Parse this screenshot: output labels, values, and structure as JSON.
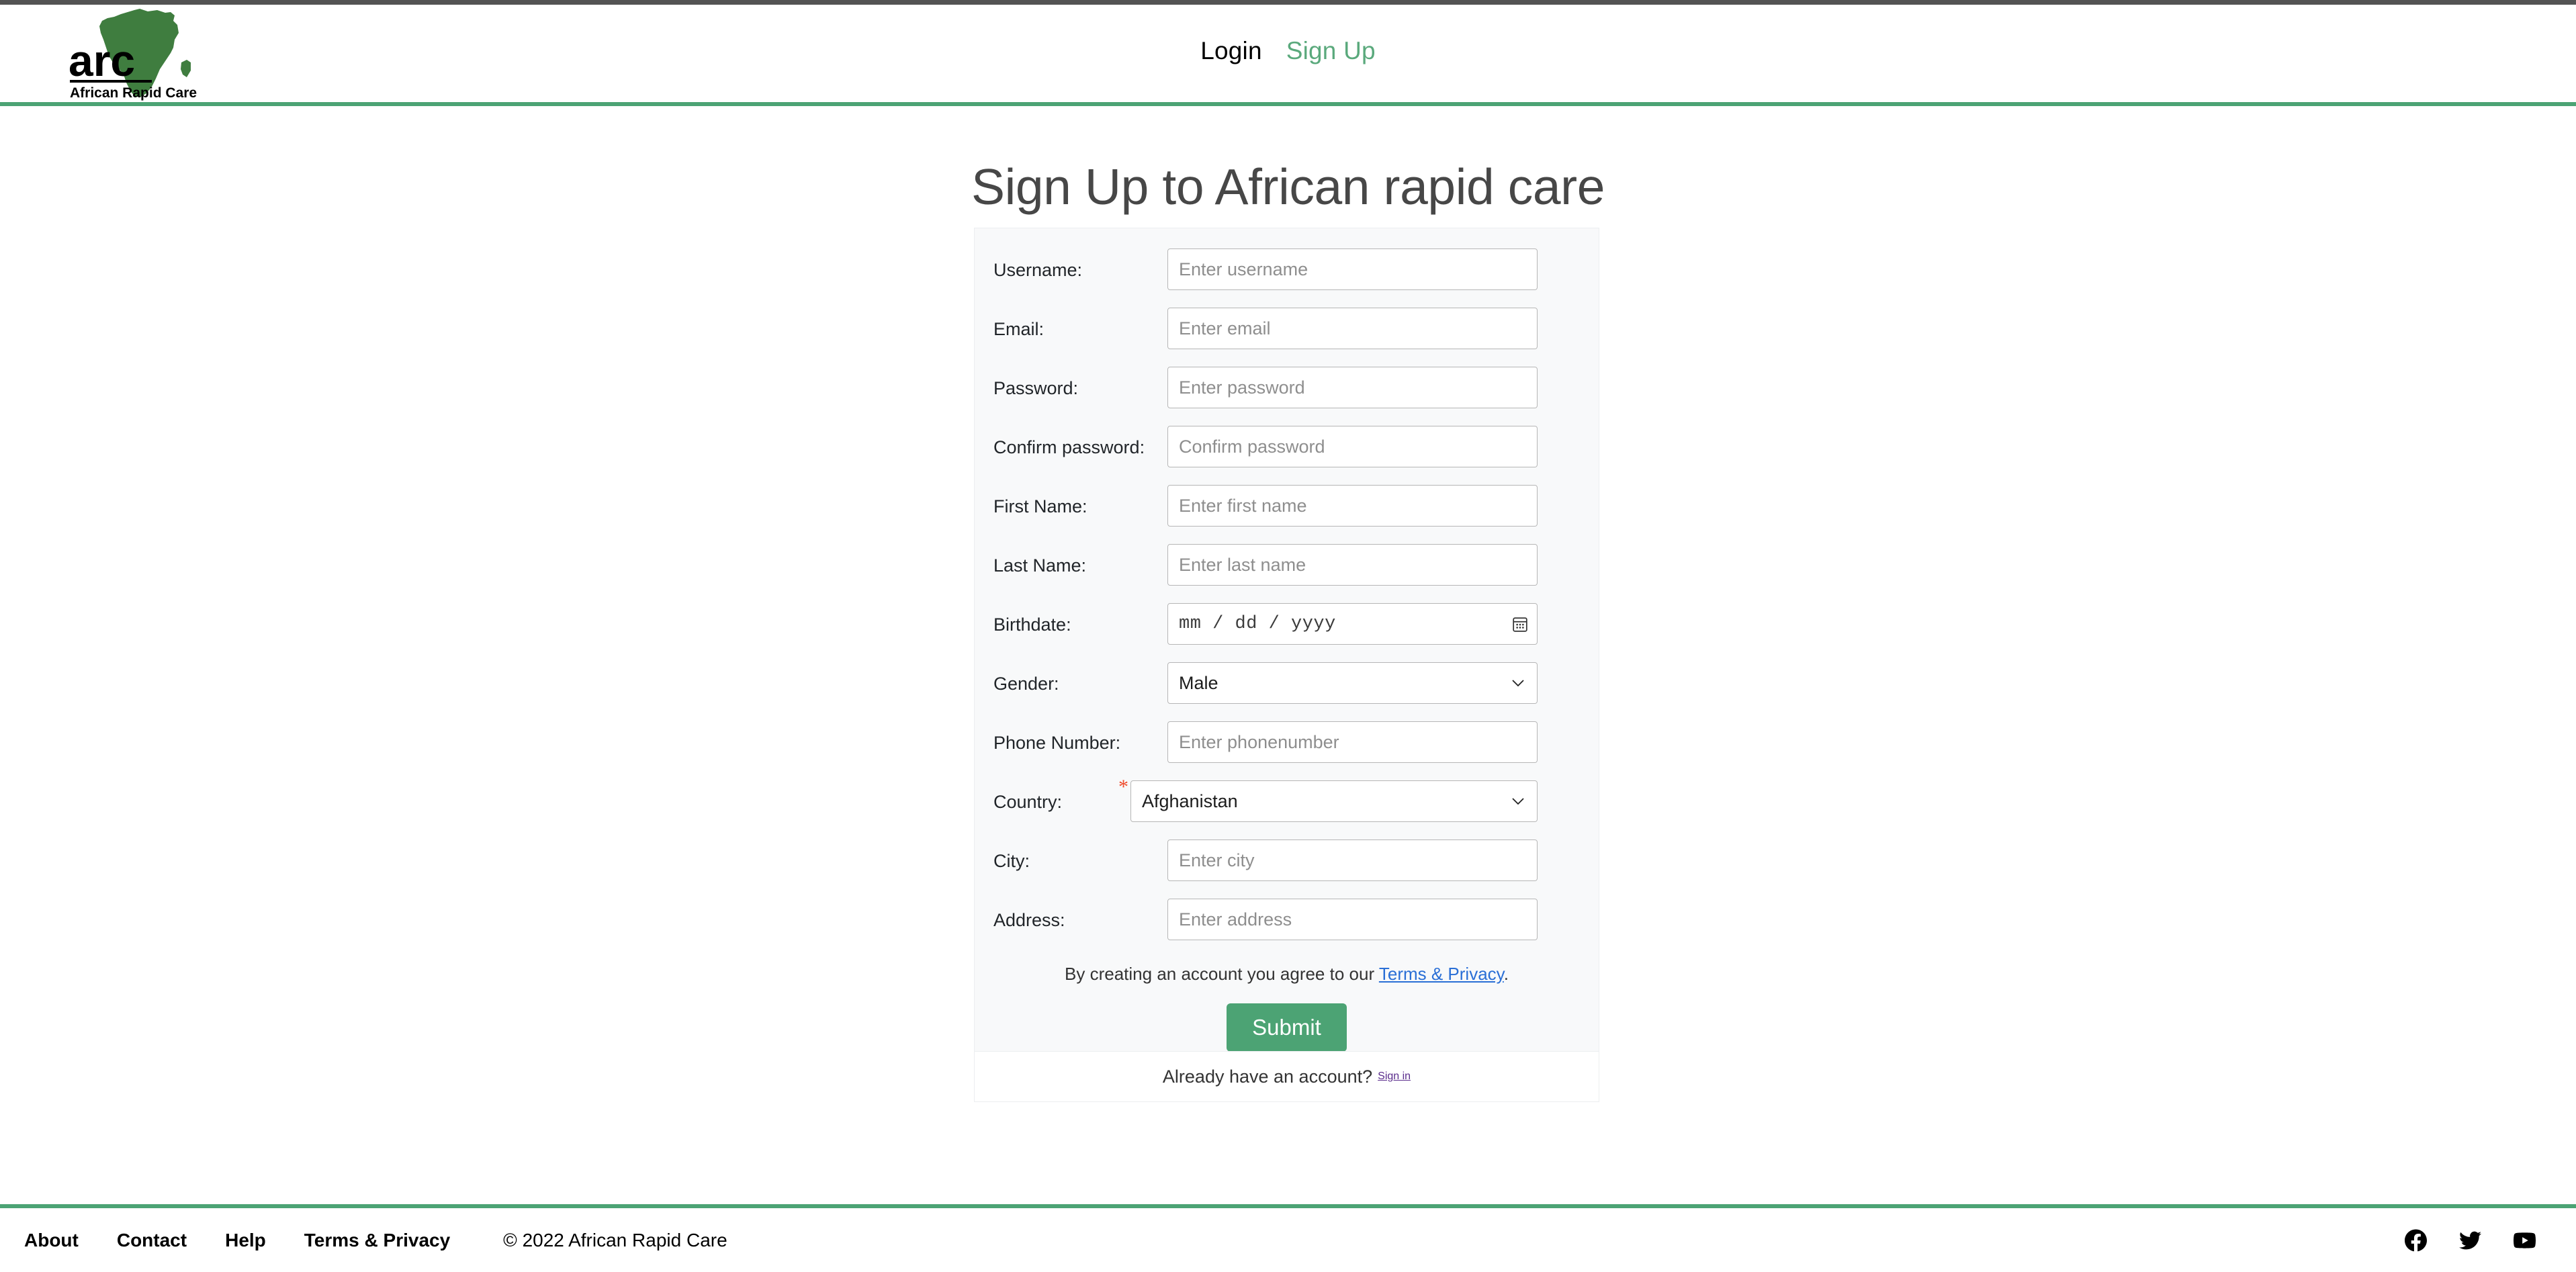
{
  "brand": {
    "logo_text_main": "arc",
    "logo_text_sub": "African Rapid Care",
    "logo_icon": "africa-map-icon",
    "green": "#4ca374"
  },
  "header": {
    "nav": {
      "login": "Login",
      "signup": "Sign Up"
    }
  },
  "page": {
    "title": "Sign Up to African rapid care"
  },
  "form": {
    "fields": [
      {
        "label": "Username:",
        "placeholder": "Enter username",
        "type": "text"
      },
      {
        "label": "Email:",
        "placeholder": "Enter email",
        "type": "text"
      },
      {
        "label": "Password:",
        "placeholder": "Enter password",
        "type": "text"
      },
      {
        "label": "Confirm password:",
        "placeholder": "Confirm password",
        "type": "text"
      },
      {
        "label": "First Name:",
        "placeholder": "Enter first name",
        "type": "text"
      },
      {
        "label": "Last Name:",
        "placeholder": "Enter last name",
        "type": "text"
      },
      {
        "label": "Birthdate:",
        "value": "mm / dd / yyyy",
        "type": "date"
      },
      {
        "label": "Gender:",
        "value": "Male",
        "type": "select"
      },
      {
        "label": "Phone Number:",
        "placeholder": "Enter phonenumber",
        "type": "text"
      },
      {
        "label": "Country:",
        "value": "Afghanistan",
        "type": "select",
        "required": true,
        "required_marker": "*"
      },
      {
        "label": "City:",
        "placeholder": "Enter city",
        "type": "text"
      },
      {
        "label": "Address:",
        "placeholder": "Enter address",
        "type": "text"
      }
    ],
    "terms_prefix": "By creating an account you agree to our ",
    "terms_link": "Terms & Privacy",
    "terms_suffix": ".",
    "submit_label": "Submit"
  },
  "signin": {
    "text": "Already have an account?",
    "link": "Sign in"
  },
  "footer": {
    "links": [
      "About",
      "Contact",
      "Help",
      "Terms & Privacy"
    ],
    "copyright": "© 2022 African Rapid Care",
    "social": [
      "facebook-icon",
      "twitter-icon",
      "youtube-icon"
    ]
  }
}
